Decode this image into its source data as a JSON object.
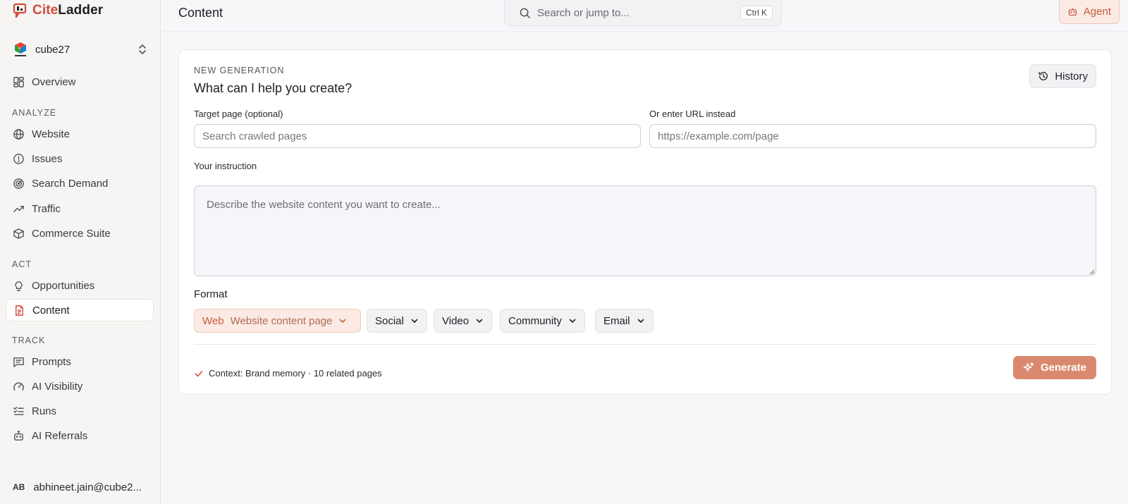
{
  "brand": {
    "name_part1": "Cite",
    "name_part2": "Ladder"
  },
  "org": {
    "name": "cube27"
  },
  "nav": {
    "overview": "Overview",
    "sections": {
      "analyze": "ANALYZE",
      "act": "ACT",
      "track": "TRACK"
    },
    "analyze_items": [
      "Website",
      "Issues",
      "Search Demand",
      "Traffic",
      "Commerce Suite"
    ],
    "act_items": [
      "Opportunities",
      "Content"
    ],
    "track_items": [
      "Prompts",
      "AI Visibility",
      "Runs",
      "AI Referrals"
    ],
    "active": "Content"
  },
  "user": {
    "initials": "AB",
    "email": "abhineet.jain@cube2..."
  },
  "header": {
    "title": "Content",
    "search_placeholder": "Search or jump to...",
    "search_shortcut": "Ctrl K",
    "agent_label": "Agent"
  },
  "card": {
    "eyebrow": "NEW GENERATION",
    "title": "What can I help you create?",
    "history_label": "History",
    "target_label": "Target page (optional)",
    "target_placeholder": "Search crawled pages",
    "url_label": "Or enter URL instead",
    "url_placeholder": "https://example.com/page",
    "instruction_label": "Your instruction",
    "instruction_placeholder": "Describe the website content you want to create...",
    "format_label": "Format",
    "formats": {
      "web_type": "Web",
      "web_value": "Website content page",
      "social": "Social",
      "video": "Video",
      "community": "Community",
      "email": "Email"
    },
    "context_text": "Context: Brand memory · 10 related pages",
    "generate_label": "Generate"
  },
  "colors": {
    "accent": "#d24a3a",
    "accent_soft": "#fbeae3",
    "generate": "#d98a6e"
  }
}
